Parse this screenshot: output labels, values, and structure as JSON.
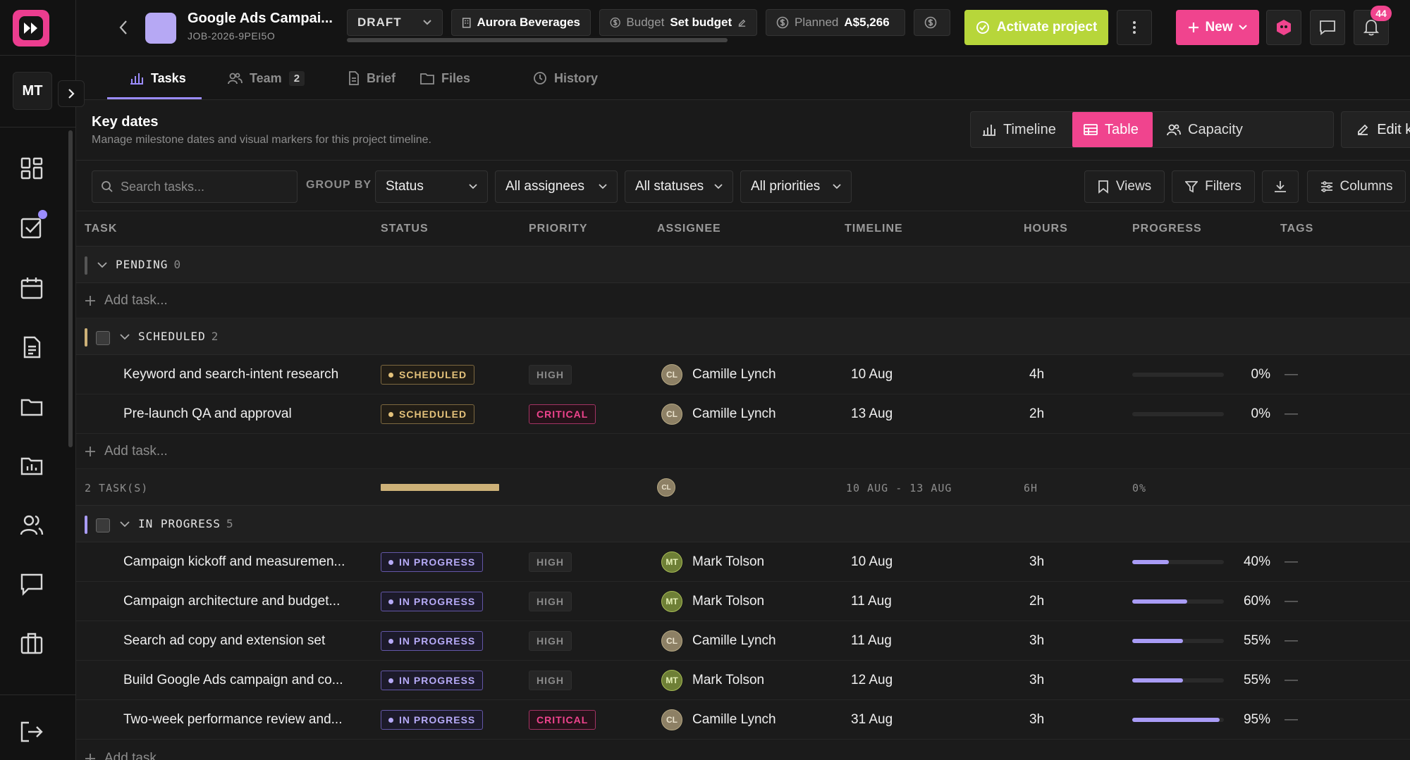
{
  "topbar": {
    "project_title": "Google Ads Campai...",
    "project_id": "JOB-2026-9PEI5O",
    "status": "DRAFT",
    "client": "Aurora Beverages",
    "budget_label": "Budget",
    "budget_value": "Set budget",
    "planned_label": "Planned",
    "planned_value": "A$5,266",
    "activate_label": "Activate project",
    "new_label": "New",
    "notif_count": "44"
  },
  "rail": {
    "user_initials": "MT"
  },
  "tabs": [
    {
      "label": "Tasks"
    },
    {
      "label": "Team",
      "count": "2"
    },
    {
      "label": "Brief"
    },
    {
      "label": "Files"
    },
    {
      "label": "History"
    }
  ],
  "key_dates": {
    "title": "Key dates",
    "subtitle": "Manage milestone dates and visual markers for this project timeline.",
    "views": [
      "Timeline",
      "Table",
      "Capacity"
    ],
    "active_view": "Table",
    "edit_label": "Edit key dates"
  },
  "filters": {
    "search_placeholder": "Search tasks...",
    "group_by_label": "GROUP BY",
    "group_by_value": "Status",
    "assignees": "All assignees",
    "statuses": "All statuses",
    "priorities": "All priorities",
    "views_label": "Views",
    "filters_label": "Filters",
    "columns_label": "Columns"
  },
  "columns": [
    "TASK",
    "STATUS",
    "PRIORITY",
    "ASSIGNEE",
    "TIMELINE",
    "HOURS",
    "PROGRESS",
    "TAGS"
  ],
  "add_task_label": "Add task...",
  "groups": {
    "pending": {
      "label": "PENDING",
      "count": "0"
    },
    "scheduled": {
      "label": "SCHEDULED",
      "count": "2",
      "summary": {
        "tasks": "2 TASK(S)",
        "assignee": "CL",
        "range": "10 AUG - 13 AUG",
        "hours": "6H",
        "progress": "0%"
      }
    },
    "in_progress": {
      "label": "IN PROGRESS",
      "count": "5"
    }
  },
  "rows": [
    {
      "task": "Keyword and search-intent research",
      "status": "SCHEDULED",
      "priority": "HIGH",
      "initials": "CL",
      "assignee": "Camille Lynch",
      "date": "10 Aug",
      "hours": "4h",
      "progress": 0,
      "pct": "0%",
      "tags": "—"
    },
    {
      "task": "Pre-launch QA and approval",
      "status": "SCHEDULED",
      "priority": "CRITICAL",
      "initials": "CL",
      "assignee": "Camille Lynch",
      "date": "13 Aug",
      "hours": "2h",
      "progress": 0,
      "pct": "0%",
      "tags": "—"
    },
    {
      "task": "Campaign kickoff and measuremen...",
      "status": "IN PROGRESS",
      "priority": "HIGH",
      "initials": "MT",
      "assignee": "Mark Tolson",
      "date": "10 Aug",
      "hours": "3h",
      "progress": 40,
      "pct": "40%",
      "tags": "—"
    },
    {
      "task": "Campaign architecture and budget...",
      "status": "IN PROGRESS",
      "priority": "HIGH",
      "initials": "MT",
      "assignee": "Mark Tolson",
      "date": "11 Aug",
      "hours": "2h",
      "progress": 60,
      "pct": "60%",
      "tags": "—"
    },
    {
      "task": "Search ad copy and extension set",
      "status": "IN PROGRESS",
      "priority": "HIGH",
      "initials": "CL",
      "assignee": "Camille Lynch",
      "date": "11 Aug",
      "hours": "3h",
      "progress": 55,
      "pct": "55%",
      "tags": "—"
    },
    {
      "task": "Build Google Ads campaign and co...",
      "status": "IN PROGRESS",
      "priority": "HIGH",
      "initials": "MT",
      "assignee": "Mark Tolson",
      "date": "12 Aug",
      "hours": "3h",
      "progress": 55,
      "pct": "55%",
      "tags": "—"
    },
    {
      "task": "Two-week performance review and...",
      "status": "IN PROGRESS",
      "priority": "CRITICAL",
      "initials": "CL",
      "assignee": "Camille Lynch",
      "date": "31 Aug",
      "hours": "3h",
      "progress": 95,
      "pct": "95%",
      "tags": "—"
    }
  ],
  "colors": {
    "accent_pink": "#f0448e",
    "accent_lime": "#b7d63a",
    "accent_purple": "#9b8cff",
    "scheduled": "#e3c17a",
    "in_progress": "#b6aaf7"
  }
}
